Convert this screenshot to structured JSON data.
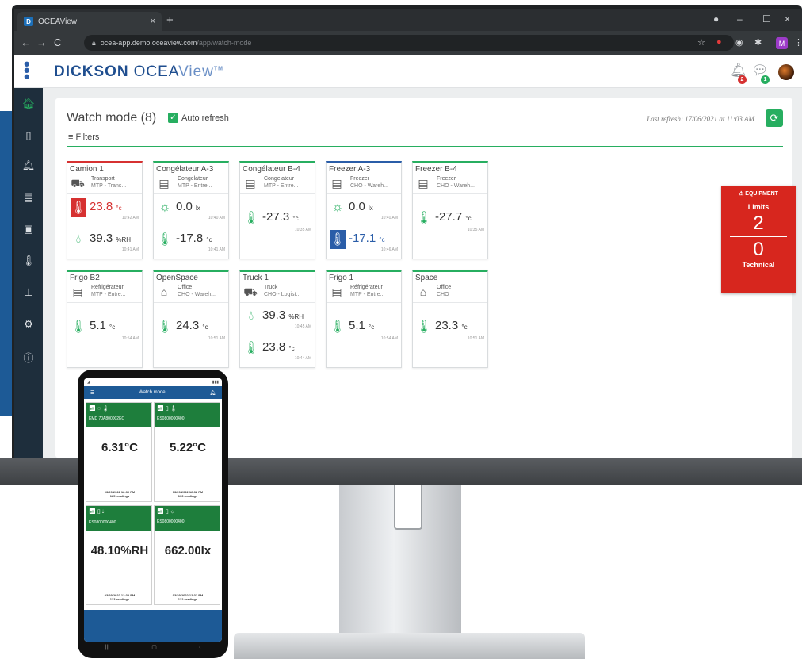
{
  "browser": {
    "tab_title": "OCEAView",
    "tab_close": "×",
    "new_tab": "+",
    "url_host": "ocea-app.demo.oceaview.com",
    "url_path": "/app/watch-mode",
    "window_controls": [
      "–",
      "☐",
      "×"
    ]
  },
  "app": {
    "brand_dickson": "DICKSON",
    "brand_ocea": "OCEA",
    "brand_view": "View",
    "brand_tm": "TM",
    "alerts_badge": "2",
    "messages_badge": "1",
    "sidebar_icons": [
      "home-icon",
      "device-icon",
      "alarm-bell-icon",
      "report-icon",
      "sensor-icon",
      "thermometer-icon",
      "hierarchy-icon",
      "settings-icon",
      "help-icon"
    ]
  },
  "panel": {
    "title": "Watch mode (8)",
    "auto_refresh_label": "Auto refresh",
    "last_refresh": "Last refresh: 17/06/2021 at 11:03 AM",
    "filters_label": "Filters"
  },
  "cards": [
    {
      "name": "Camion 1",
      "type": "Transport",
      "location": "MTP - Trans...",
      "icon": "truck-icon",
      "status": "red",
      "readings": [
        {
          "icon": "thermometer-icon",
          "value": "23.8",
          "unit": "°c",
          "time": "10:42 AM",
          "state": "alarm"
        },
        {
          "icon": "humidity-drop-icon",
          "value": "39.3",
          "unit": "%RH",
          "time": "10:41 AM",
          "state": "normal"
        }
      ]
    },
    {
      "name": "Congélateur A-3",
      "type": "Congelateur",
      "location": "MTP - Entre...",
      "icon": "freezer-icon",
      "status": "green",
      "readings": [
        {
          "icon": "light-bulb-icon",
          "value": "0.0",
          "unit": "lx",
          "time": "10:40 AM",
          "state": "normal"
        },
        {
          "icon": "thermometer-icon",
          "value": "-17.8",
          "unit": "°c",
          "time": "10:41 AM",
          "state": "normal"
        }
      ]
    },
    {
      "name": "Congélateur B-4",
      "type": "Congelateur",
      "location": "MTP - Entre...",
      "icon": "freezer-icon",
      "status": "green",
      "readings": [
        {
          "icon": "thermometer-icon",
          "value": "-27.3",
          "unit": "°c",
          "time": "10:35 AM",
          "state": "normal"
        }
      ]
    },
    {
      "name": "Freezer A-3",
      "type": "Freezer",
      "location": "CHO - Wareh...",
      "icon": "freezer-icon",
      "status": "blue",
      "readings": [
        {
          "icon": "light-bulb-icon",
          "value": "0.0",
          "unit": "lx",
          "time": "10:40 AM",
          "state": "normal"
        },
        {
          "icon": "thermometer-icon",
          "value": "-17.1",
          "unit": "°c",
          "time": "10:46 AM",
          "state": "low"
        }
      ]
    },
    {
      "name": "Freezer B-4",
      "type": "Freezer",
      "location": "CHO - Wareh...",
      "icon": "freezer-icon",
      "status": "green",
      "readings": [
        {
          "icon": "thermometer-icon",
          "value": "-27.7",
          "unit": "°c",
          "time": "10:35 AM",
          "state": "normal"
        }
      ]
    },
    {
      "name": "Frigo B2",
      "type": "Réfrigérateur",
      "location": "MTP - Entre...",
      "icon": "fridge-icon",
      "status": "green",
      "readings": [
        {
          "icon": "thermometer-icon",
          "value": "5.1",
          "unit": "°c",
          "time": "10:54 AM",
          "state": "normal"
        }
      ]
    },
    {
      "name": "OpenSpace",
      "type": "Office",
      "location": "CHO - Wareh...",
      "icon": "house-icon",
      "status": "green",
      "readings": [
        {
          "icon": "thermometer-icon",
          "value": "24.3",
          "unit": "°c",
          "time": "10:51 AM",
          "state": "normal"
        }
      ]
    },
    {
      "name": "Truck 1",
      "type": "Truck",
      "location": "CHO - Logist...",
      "icon": "truck-icon",
      "status": "green",
      "readings": [
        {
          "icon": "humidity-drop-icon",
          "value": "39.3",
          "unit": "%RH",
          "time": "10:45 AM",
          "state": "normal"
        },
        {
          "icon": "thermometer-icon",
          "value": "23.8",
          "unit": "°c",
          "time": "10:44 AM",
          "state": "normal"
        }
      ]
    },
    {
      "name": "Frigo 1",
      "type": "Réfrigérateur",
      "location": "MTP - Entre...",
      "icon": "fridge-icon",
      "status": "green",
      "readings": [
        {
          "icon": "thermometer-icon",
          "value": "5.1",
          "unit": "°c",
          "time": "10:54 AM",
          "state": "normal"
        }
      ]
    },
    {
      "name": "Space",
      "type": "Office",
      "location": "CHO",
      "icon": "house-icon",
      "status": "green",
      "readings": [
        {
          "icon": "thermometer-icon",
          "value": "23.3",
          "unit": "°c",
          "time": "10:51 AM",
          "state": "normal"
        }
      ]
    }
  ],
  "equipment": {
    "title": "EQUIPMENT",
    "limits_label": "Limits",
    "limits_count": "2",
    "technical_count": "0",
    "technical_label": "Technical"
  },
  "phone": {
    "title": "Watch mode",
    "tiles": [
      {
        "id": "EMD 70A800002EC",
        "value": "6.31°C",
        "date": "03/29/2022 12:30 PM",
        "readings": "125 readings"
      },
      {
        "id": "ES0800000400",
        "value": "5.22°C",
        "date": "03/29/2022 12:32 PM",
        "readings": "133 readings"
      },
      {
        "id": "ES0800000400",
        "value": "48.10%RH",
        "date": "03/29/2022 12:32 PM",
        "readings": "133 readings"
      },
      {
        "id": "ES0800000400",
        "value": "662.00lx",
        "date": "03/29/2022 12:32 PM",
        "readings": "132 readings"
      }
    ]
  },
  "colors": {
    "accent_green": "#27ae60",
    "alarm_red": "#d63131",
    "low_blue": "#2a5da8",
    "sidebar": "#1e2e3c",
    "brand_blue": "#1f4e8f"
  }
}
